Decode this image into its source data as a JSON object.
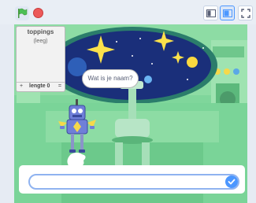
{
  "colors": {
    "accent": "#4c97ff",
    "flag": "#4cbf56",
    "stop": "#ec5959"
  },
  "controls": {
    "green_flag_icon": "green-flag-icon",
    "stop_icon": "stop-sign-icon",
    "small_stage_icon": "small-stage-layout-icon",
    "normal_stage_icon": "normal-stage-layout-icon",
    "fullscreen_icon": "fullscreen-icon"
  },
  "list_monitor": {
    "title": "toppings",
    "empty_text": "(leeg)",
    "add_symbol": "+",
    "length_label": "lengte 0",
    "resize_symbol": "="
  },
  "speech_bubble": {
    "text": "Wat is je naam?"
  },
  "ask_prompt": {
    "value": "",
    "submit_icon": "checkmark-icon"
  }
}
